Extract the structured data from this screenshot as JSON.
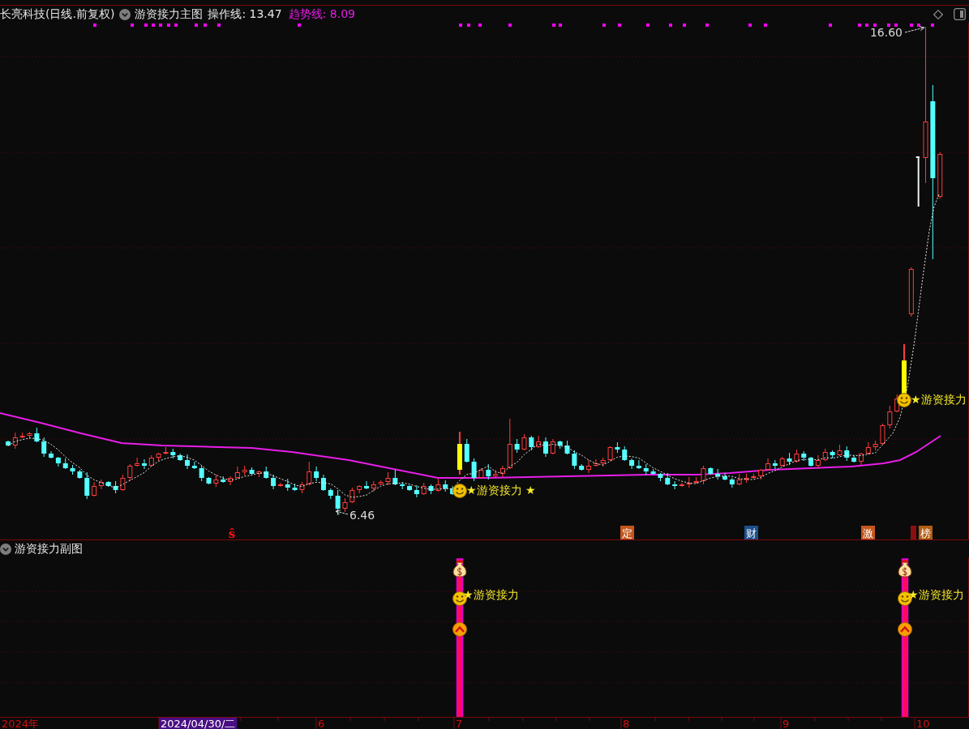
{
  "header": {
    "title": "长亮科技(日线.前复权)",
    "indicator": "游资接力主图",
    "values": [
      {
        "label": "操作线: 13.47",
        "kind": "operation",
        "color": "#e6e6e6"
      },
      {
        "label": "趋势线: 8.09",
        "kind": "trend",
        "color": "#e81ee8"
      }
    ]
  },
  "main_chart": {
    "high_label": "16.60",
    "low_label": "6.46",
    "signals": [
      {
        "text": "★游资接力 ★"
      },
      {
        "text": "★游资接力"
      }
    ],
    "event_markers": [
      {
        "kind": "glyph",
        "text": "ŝ",
        "color": "#ff1010"
      },
      {
        "kind": "tag",
        "text": "定",
        "color": "#c4561c"
      },
      {
        "kind": "tag",
        "text": "财",
        "color": "#1d4f8c"
      },
      {
        "kind": "tag",
        "text": "激",
        "color": "#c4561c"
      },
      {
        "kind": "stub",
        "color": "#8a1010"
      },
      {
        "kind": "tag",
        "text": "榜",
        "color": "#b35d12"
      }
    ]
  },
  "sub_chart": {
    "title": "游资接力副图",
    "signals": [
      {
        "text": "★游资接力"
      },
      {
        "text": "★游资接力"
      }
    ]
  },
  "time_axis": {
    "labels": [
      {
        "text": "2024年",
        "highlighted": false
      },
      {
        "text": "2024/04/30/二",
        "highlighted": true
      },
      {
        "text": "6",
        "highlighted": false
      },
      {
        "text": "7",
        "highlighted": false
      },
      {
        "text": "8",
        "highlighted": false
      },
      {
        "text": "9",
        "highlighted": false
      },
      {
        "text": "10",
        "highlighted": false
      }
    ]
  }
}
